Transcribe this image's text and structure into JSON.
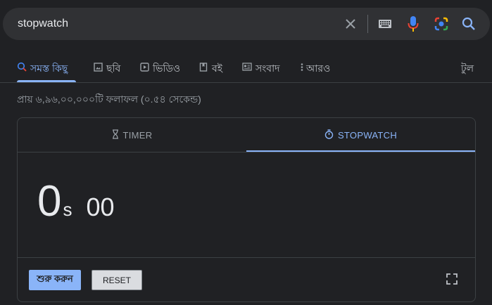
{
  "search": {
    "query": "stopwatch"
  },
  "icons": {
    "clear": "close-icon",
    "keyboard": "keyboard-icon",
    "mic": "microphone-icon",
    "lens": "lens-camera-icon",
    "search": "search-icon"
  },
  "tabs": {
    "items": [
      {
        "label": "সমস্ত কিছু",
        "icon": "search-icon",
        "active": true
      },
      {
        "label": "ছবি",
        "icon": "image-icon",
        "active": false
      },
      {
        "label": "ভিডিও",
        "icon": "video-icon",
        "active": false
      },
      {
        "label": "বই",
        "icon": "book-icon",
        "active": false
      },
      {
        "label": "সংবাদ",
        "icon": "news-icon",
        "active": false
      },
      {
        "label": "আরও",
        "icon": "more-vertical-icon",
        "active": false
      }
    ],
    "tools": "টুল"
  },
  "results": {
    "stats": "প্রায় ৬,৯৬,০০,০০০টি ফলাফল (০.৫৪ সেকেন্ড)"
  },
  "widget": {
    "tab_timer": "TIMER",
    "tab_stopwatch": "STOPWATCH",
    "seconds": "0",
    "seconds_unit": "s",
    "centiseconds": "00",
    "start_label": "শুরু করুন",
    "reset_label": "RESET"
  },
  "colors": {
    "background": "#202124",
    "accent": "#8ab4f8",
    "searchbar": "#303134"
  }
}
